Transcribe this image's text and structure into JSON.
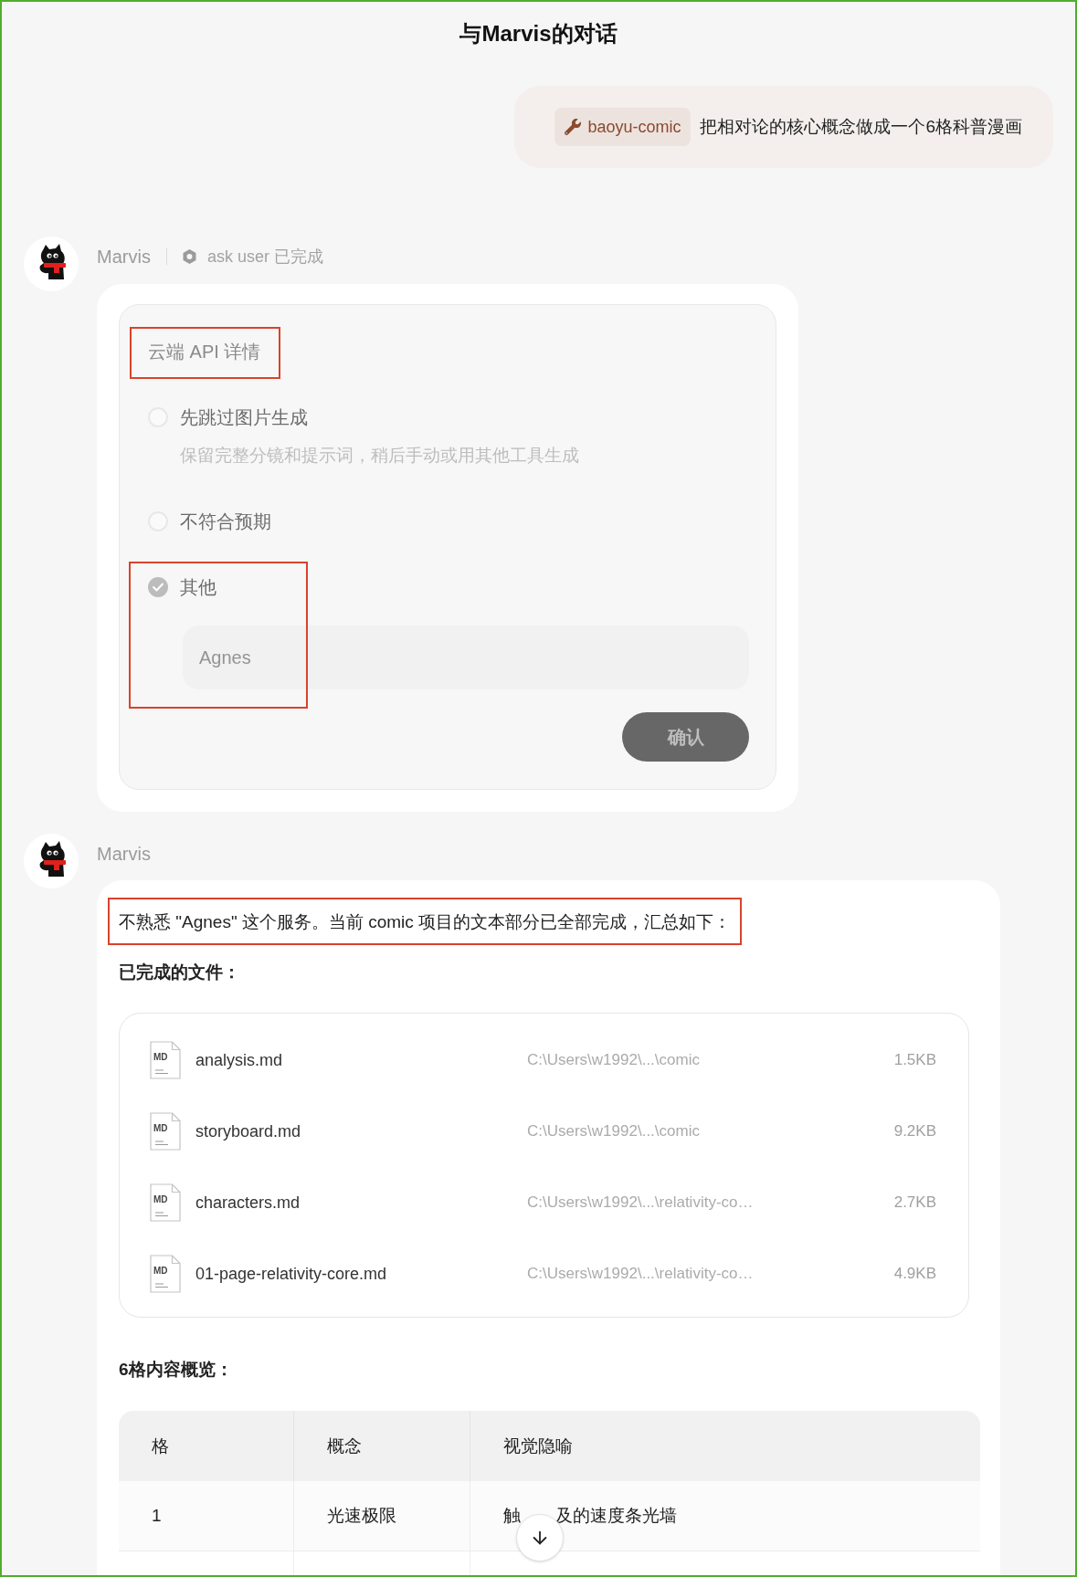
{
  "header": {
    "title": "与Marvis的对话"
  },
  "messages": [
    {
      "kind": "user",
      "skill": "baoyu-comic",
      "text": "把相对论的核心概念做成一个6格科普漫画"
    },
    {
      "kind": "ask",
      "sender": "Marvis",
      "status": "ask user 已完成",
      "question": {
        "title": "云端 API 详情",
        "annotated": true,
        "options": [
          {
            "label": "先跳过图片生成",
            "description": "保留完整分镜和提示词，稍后手动或用其他工具生成",
            "selected": false,
            "annotated": false
          },
          {
            "label": "不符合预期",
            "selected": false,
            "annotated": false
          },
          {
            "label": "其他",
            "selected": true,
            "annotated": true,
            "input": {
              "value": "Agnes"
            }
          }
        ],
        "confirm_button": {
          "label": "确认",
          "disabled": true
        }
      }
    },
    {
      "kind": "reply",
      "sender": "Marvis",
      "blocks": [
        {
          "kind": "paragraph",
          "text": "不熟悉 \"Agnes\" 这个服务。当前 comic 项目的文本部分已全部完成，汇总如下：",
          "annotated": true
        },
        {
          "kind": "heading",
          "text": "已完成的文件："
        },
        {
          "kind": "files",
          "files": [
            {
              "type_label": "MD",
              "name": "analysis.md",
              "path": "C:\\Users\\w1992\\...\\comic",
              "size": "1.5KB"
            },
            {
              "type_label": "MD",
              "name": "storyboard.md",
              "path": "C:\\Users\\w1992\\...\\comic",
              "size": "9.2KB"
            },
            {
              "type_label": "MD",
              "name": "characters.md",
              "path": "C:\\Users\\w1992\\...\\relativity-co…",
              "size": "2.7KB"
            },
            {
              "type_label": "MD",
              "name": "01-page-relativity-core.md",
              "path": "C:\\Users\\w1992\\...\\relativity-co…",
              "size": "4.9KB"
            }
          ]
        },
        {
          "kind": "heading",
          "text": "6格内容概览："
        },
        {
          "kind": "table",
          "columns": [
            "格",
            "概念",
            "视觉隐喻"
          ],
          "rows": [
            [
              "1",
              "光速极限",
              [
                "触",
                "及的速度条光墙"
              ]
            ]
          ]
        }
      ]
    }
  ]
}
